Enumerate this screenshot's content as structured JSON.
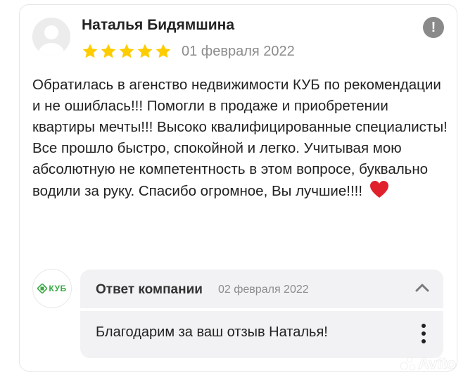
{
  "review": {
    "author": "Наталья Бидямшина",
    "rating": 5,
    "date": "01 февраля 2022",
    "text": "Обратилась в агенство недвижимости КУБ по рекомендации и не ошиблась!!! Помогли в продаже и приобретении квартиры мечты!!! Высоко квалифицированные специалисты! Все прошло быстро, спокойной и легко. Учитывая мою абсолютную не компетентность в этом вопросе, буквально водили за руку. Спасибо огромное, Вы лучшие!!!! ",
    "star_color": "#ffcc00",
    "heart_color": "#e0202a",
    "flag_icon": "exclamation-icon"
  },
  "company_reply": {
    "logo_text": "КУБ",
    "heading": "Ответ компании",
    "date": "02 февраля 2022",
    "text": "Благодарим за ваш отзыв Наталья!",
    "logo_color": "#3aa845",
    "collapse_icon": "chevron-up-icon",
    "menu_icon": "kebab-menu-icon"
  },
  "watermark": {
    "text": "Avito"
  }
}
